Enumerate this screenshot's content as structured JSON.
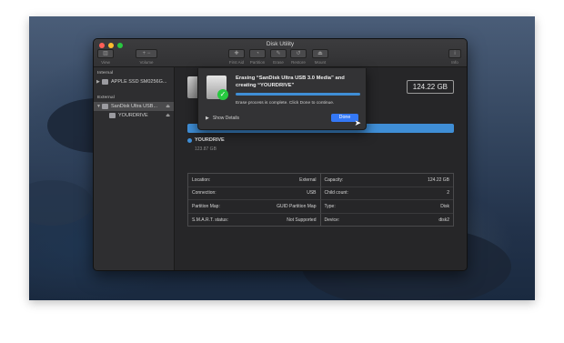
{
  "window": {
    "title": "Disk Utility"
  },
  "toolbar": [
    {
      "label": "View",
      "icon": "sidebar-icon",
      "symbol": "▥"
    },
    {
      "label": "Volume",
      "icon": "plus-minus-icon",
      "symbol": "+ −"
    },
    {
      "label": "First Aid",
      "icon": "stethoscope-icon",
      "symbol": "✚"
    },
    {
      "label": "Partition",
      "icon": "partition-icon",
      "symbol": "◔"
    },
    {
      "label": "Erase",
      "icon": "erase-icon",
      "symbol": "✎"
    },
    {
      "label": "Restore",
      "icon": "restore-icon",
      "symbol": "↺"
    },
    {
      "label": "Mount",
      "icon": "mount-icon",
      "symbol": "⏏"
    },
    {
      "label": "Info",
      "icon": "info-icon",
      "symbol": "i"
    }
  ],
  "sidebar": {
    "internal_header": "Internal",
    "external_header": "External",
    "internal_items": [
      {
        "label": "APPLE SSD SM0256G..."
      }
    ],
    "external_items": [
      {
        "label": "SanDisk Ultra USB...",
        "selected": true
      },
      {
        "label": "YOURDRIVE"
      }
    ]
  },
  "main": {
    "capacity_badge": "124.22 GB",
    "volume_name": "YOURDRIVE",
    "volume_size": "123.87 GB",
    "info_rows": [
      {
        "left_label": "Location:",
        "left_value": "External",
        "right_label": "Capacity:",
        "right_value": "124.22 GB"
      },
      {
        "left_label": "Connection:",
        "left_value": "USB",
        "right_label": "Child count:",
        "right_value": "2"
      },
      {
        "left_label": "Partition Map:",
        "left_value": "GUID Partition Map",
        "right_label": "Type:",
        "right_value": "Disk"
      },
      {
        "left_label": "S.M.A.R.T. status:",
        "left_value": "Not Supported",
        "right_label": "Device:",
        "right_value": "disk2"
      }
    ]
  },
  "sheet": {
    "title": "Erasing “SanDisk Ultra USB 3.0 Media” and creating “YOURDRIVE”",
    "message": "Erase process is complete. Click Done to continue.",
    "show_details": "Show Details",
    "done": "Done",
    "progress": 1.0
  },
  "colors": {
    "accent": "#3f8ed6",
    "done_button": "#3478f6",
    "success": "#28c840"
  }
}
